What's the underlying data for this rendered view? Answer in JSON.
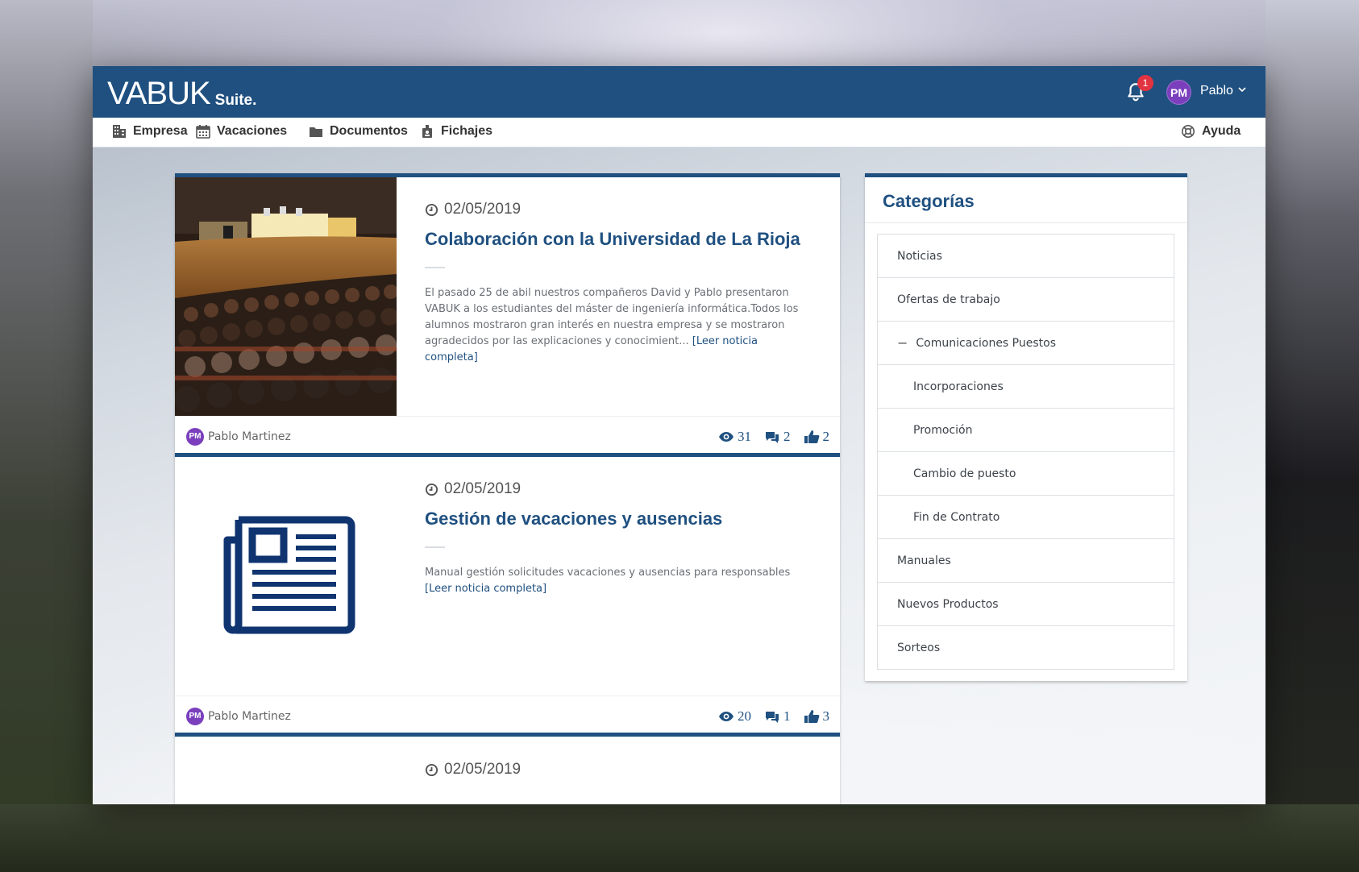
{
  "app": {
    "logo_main": "VABUK",
    "logo_sub": "Suite."
  },
  "header": {
    "notification_count": "1",
    "user_initials": "PM",
    "user_name": "Pablo"
  },
  "nav": {
    "items": [
      {
        "label": "Empresa",
        "icon": "building-icon"
      },
      {
        "label": "Vacaciones",
        "icon": "calendar-icon"
      },
      {
        "label": "Documentos",
        "icon": "folder-icon"
      },
      {
        "label": "Fichajes",
        "icon": "badge-icon"
      }
    ],
    "help": {
      "label": "Ayuda",
      "icon": "lifebuoy-icon"
    }
  },
  "posts": [
    {
      "date": "02/05/2019",
      "title": "Colaboración con la Universidad de La Rioja",
      "excerpt": "El pasado 25 de abil nuestros compañeros David y Pablo presentaron VABUK a los estudiantes del máster de ingeniería informática.Todos los alumnos mostraron gran interés en nuestra empresa y se mostraron agradecidos por las explicaciones y conocimient...",
      "read_more": "[Leer noticia completa]",
      "author_initials": "PM",
      "author": "Pablo Martinez",
      "views": "31",
      "comments": "2",
      "likes": "2"
    },
    {
      "date": "02/05/2019",
      "title": "Gestión de vacaciones y ausencias",
      "excerpt": "Manual gestión solicitudes vacaciones y ausencias para responsables",
      "read_more": "[Leer noticia completa]",
      "author_initials": "PM",
      "author": "Pablo Martinez",
      "views": "20",
      "comments": "1",
      "likes": "3"
    },
    {
      "date": "02/05/2019"
    }
  ],
  "sidebar": {
    "title": "Categorías",
    "categories": [
      {
        "label": "Noticias"
      },
      {
        "label": "Ofertas de trabajo"
      },
      {
        "label": "Comunicaciones Puestos",
        "expanded_marker": "−"
      },
      {
        "label": "Incorporaciones"
      },
      {
        "label": "Promoción"
      },
      {
        "label": "Cambio de puesto"
      },
      {
        "label": "Fin de Contrato"
      },
      {
        "label": "Manuales"
      },
      {
        "label": "Nuevos Productos"
      },
      {
        "label": "Sorteos"
      }
    ]
  },
  "colors": {
    "primary": "#1f5080",
    "badge": "#e23340",
    "avatar": "#7b3fbd"
  }
}
